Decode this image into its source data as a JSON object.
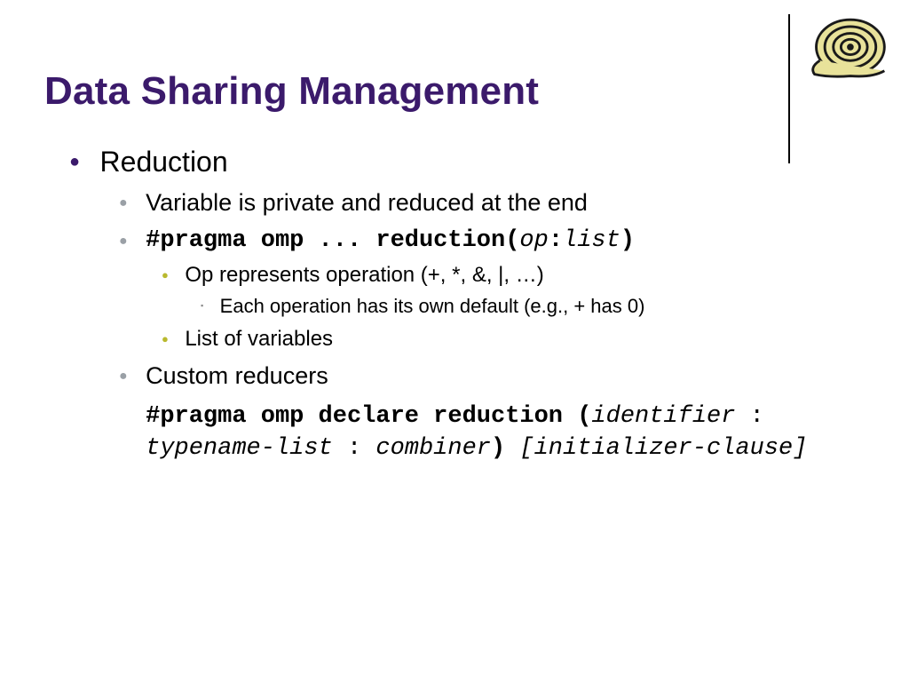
{
  "title": "Data Sharing Management",
  "l1": {
    "item1": "Reduction"
  },
  "l2": {
    "item1": "Variable is private and reduced at the end",
    "item2_prefix": "#pragma omp ... reduction(",
    "item2_op": "op",
    "item2_colon": ":",
    "item2_list": "list",
    "item2_suffix": ")",
    "item3": "Custom reducers",
    "code2_a": "#pragma omp declare reduction (",
    "code2_b": "identifier",
    "code2_c": " : ",
    "code2_d": "typename-list",
    "code2_e": " : ",
    "code2_f": "combiner",
    "code2_g": ")",
    "code2_h": " [initializer-clause]"
  },
  "l3": {
    "item1": "Op represents operation (+, *, &, |, …)",
    "item2": "List of variables"
  },
  "l4": {
    "item1": "Each operation has its own default (e.g., + has 0)"
  },
  "bullets": {
    "round": "●",
    "square": "▪"
  }
}
